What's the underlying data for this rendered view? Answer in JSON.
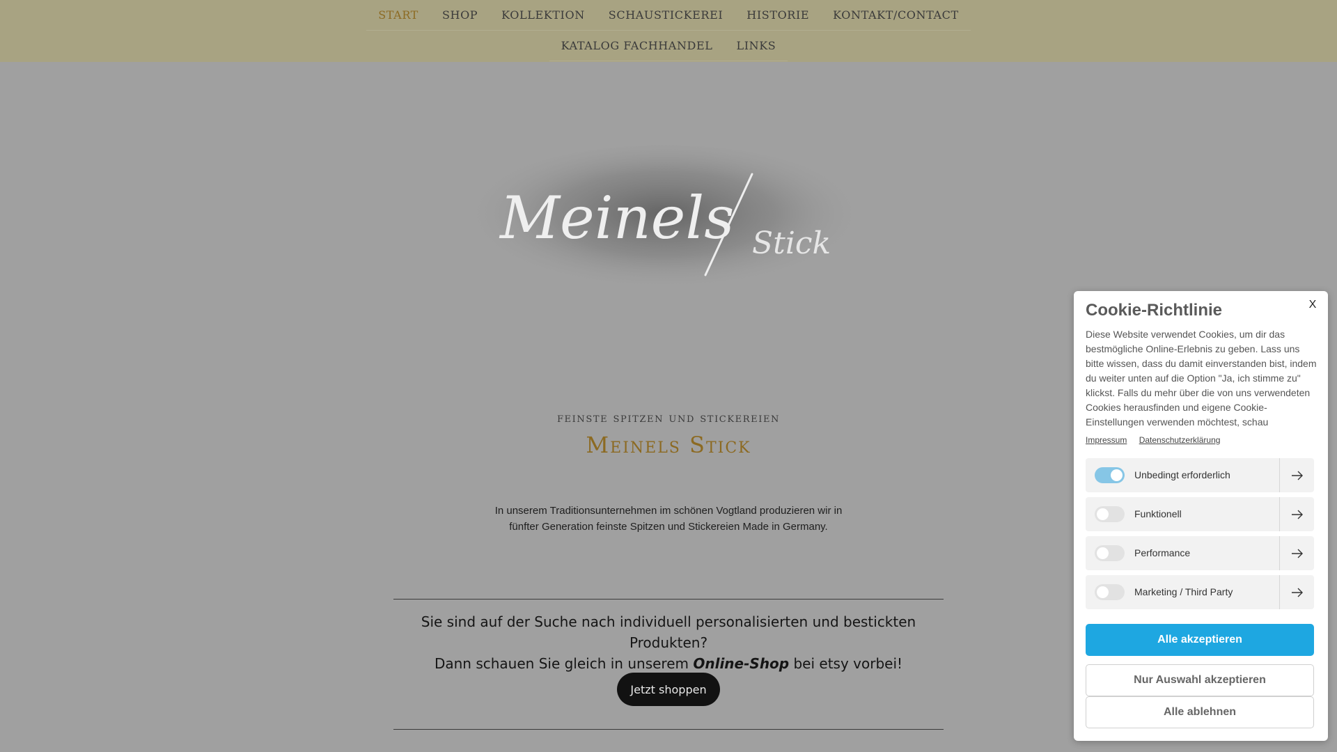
{
  "nav": {
    "row1": [
      {
        "label": "Start",
        "active": true
      },
      {
        "label": "Shop"
      },
      {
        "label": "Kollektion"
      },
      {
        "label": "Schaustickerei"
      },
      {
        "label": "Historie"
      },
      {
        "label": "Kontakt/Contact"
      }
    ],
    "row2": [
      {
        "label": "Katalog Fachhandel"
      },
      {
        "label": "Links"
      }
    ]
  },
  "logo": {
    "main": "Meinels",
    "secondary": "Stick"
  },
  "hero": {
    "kicker": "feinste Spitzen und Stickereien",
    "title": "Meinels Stick",
    "intro": "In unserem Traditionsunternehmen im schönen Vogtland produzieren wir in fünfter Generation feinste Spitzen und Stickereien Made in Germany."
  },
  "shop": {
    "line1": "Sie sind auf der Suche nach individuell personalisierten und bestickten Produkten?",
    "line2_pre": "Dann schauen Sie gleich in unserem",
    "line2_bold": "Online-Shop",
    "line2_post": "bei etsy vorbei!",
    "button": "Jetzt shoppen"
  },
  "cookie": {
    "title": "Cookie-Richtlinie",
    "close": "X",
    "text": "Diese Website verwendet Cookies, um dir das bestmögliche Online-Erlebnis zu geben. Lass uns bitte wissen, dass du damit einverstanden bist, indem du weiter unten auf die Option \"Ja, ich stimme zu\" klickst. Falls du mehr über die von uns verwendeten Cookies herausfinden und eigene Cookie-Einstellungen verwenden möchtest, schau",
    "links": [
      "Impressum",
      "Datenschutzerklärung"
    ],
    "categories": [
      {
        "label": "Unbedingt erforderlich",
        "on": true
      },
      {
        "label": "Funktionell",
        "on": false
      },
      {
        "label": "Performance",
        "on": false
      },
      {
        "label": "Marketing / Third Party",
        "on": false
      }
    ],
    "buttons": {
      "accept_all": "Alle akzeptieren",
      "accept_selection": "Nur Auswahl akzeptieren",
      "reject_all": "Alle ablehnen"
    }
  },
  "colors": {
    "nav_bg": "#a8a382",
    "page_bg": "#a0a0a0",
    "accent_gold": "#8c6a22",
    "cookie_primary": "#1ea7e1",
    "toggle_on": "#86c6e6"
  }
}
